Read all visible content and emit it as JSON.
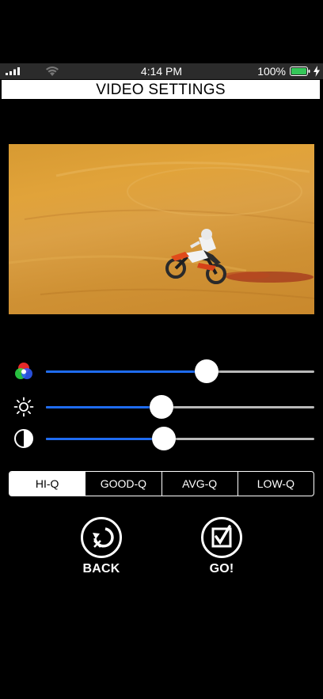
{
  "status_bar": {
    "time": "4:14 PM",
    "battery_percent": "100%",
    "icons": [
      "signal-icon",
      "wifi-icon",
      "battery-icon",
      "charging-icon"
    ]
  },
  "header": {
    "title": "VIDEO SETTINGS"
  },
  "preview": {
    "icon": "video-preview-image"
  },
  "sliders": [
    {
      "name": "color",
      "icon": "color-circles-icon",
      "value": 0.6
    },
    {
      "name": "brightness",
      "icon": "brightness-sun-icon",
      "value": 0.43
    },
    {
      "name": "contrast",
      "icon": "contrast-icon",
      "value": 0.44
    }
  ],
  "quality": {
    "options": [
      "HI-Q",
      "GOOD-Q",
      "AVG-Q",
      "LOW-Q"
    ],
    "selected": "HI-Q"
  },
  "actions": {
    "back_label": "BACK",
    "go_label": "GO!"
  },
  "colors": {
    "accent": "#1f6cf1",
    "battery": "#35c759",
    "track": "#b9b9b9",
    "background": "#000000"
  }
}
